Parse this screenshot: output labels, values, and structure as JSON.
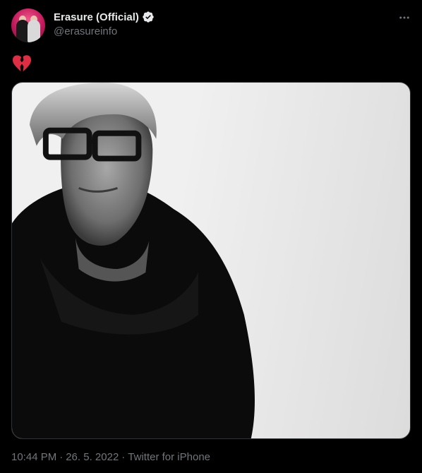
{
  "author": {
    "display_name": "Erasure (Official)",
    "handle": "@erasureinfo",
    "verified": true
  },
  "tweet": {
    "text_icon": "broken-heart-icon",
    "media_type": "photo"
  },
  "meta": {
    "time": "10:44 PM",
    "separator": "·",
    "date": "26. 5. 2022",
    "source": "Twitter for iPhone"
  },
  "icons": {
    "more": "more-horizontal-icon",
    "verified": "verified-badge-icon"
  },
  "colors": {
    "background": "#000000",
    "primary_text": "#e7e9ea",
    "secondary_text": "#71767b",
    "heart": "#e0245e"
  }
}
